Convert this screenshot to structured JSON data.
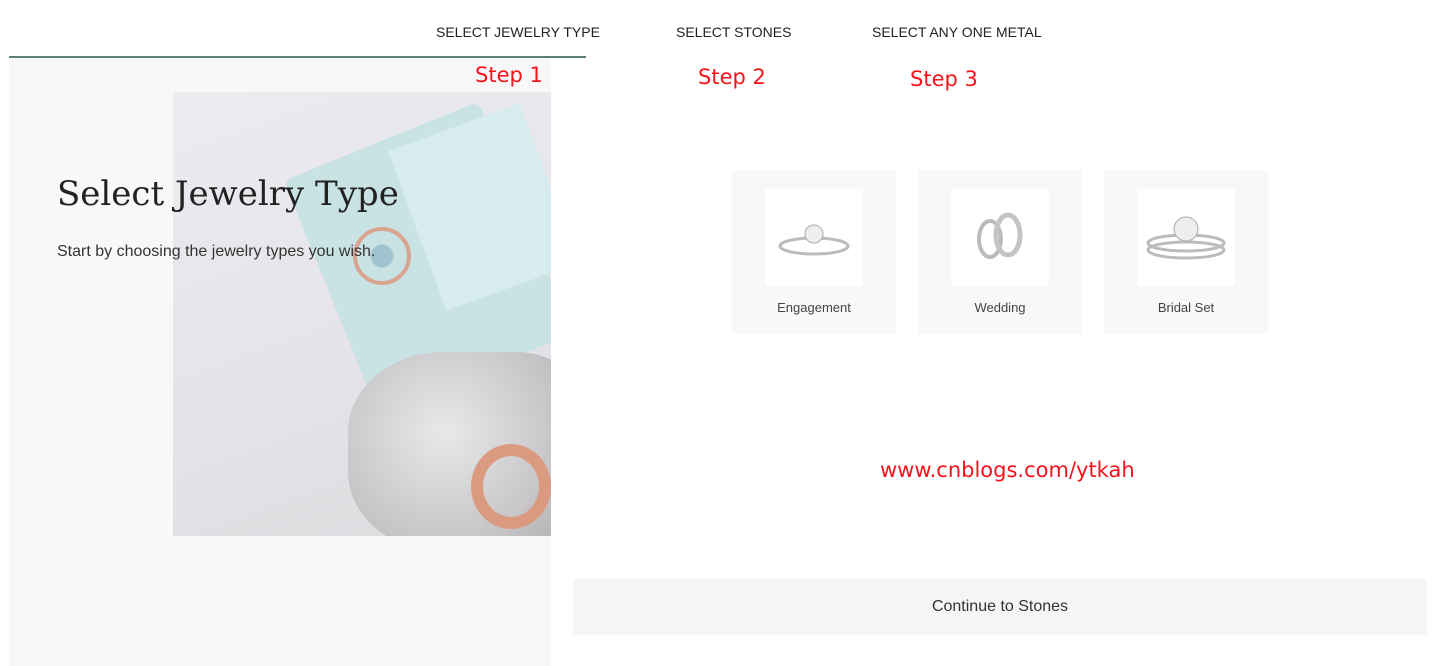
{
  "steps": [
    {
      "label": "SELECT JEWELRY TYPE",
      "active": true
    },
    {
      "label": "SELECT STONES",
      "active": false
    },
    {
      "label": "SELECT ANY ONE METAL",
      "active": false
    }
  ],
  "annotations": [
    "Step 1",
    "Step 2",
    "Step 3"
  ],
  "intro": {
    "title": "Select Jewelry Type",
    "description": "Start by choosing the jewelry types you wish."
  },
  "types": [
    {
      "label": "Engagement",
      "icon": "engagement-ring-icon"
    },
    {
      "label": "Wedding",
      "icon": "wedding-bands-icon"
    },
    {
      "label": "Bridal Set",
      "icon": "bridal-set-icon"
    }
  ],
  "watermark": "www.cnblogs.com/ytkah",
  "continue_label": "Continue to Stones",
  "colors": {
    "active_underline": "#5f7f7c",
    "annotation": "#f5141a"
  }
}
